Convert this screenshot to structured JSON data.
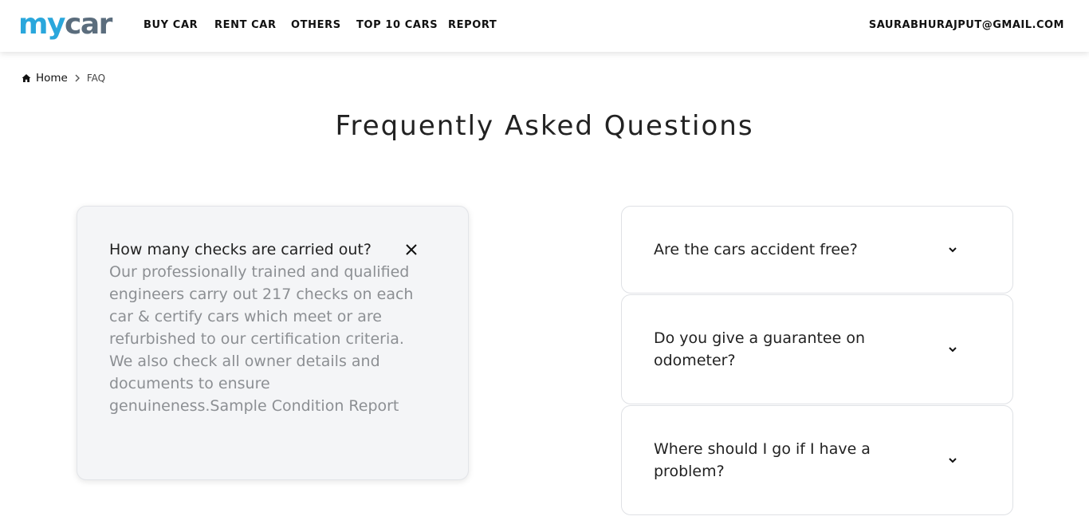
{
  "header": {
    "logo_part1": "my",
    "logo_part2": "car",
    "nav": [
      "BUY CAR",
      "RENT CAR",
      "OTHERS",
      "TOP 10 CARS",
      "REPORT"
    ],
    "user_email": "SAURABHURAJPUT@GMAIL.COM"
  },
  "breadcrumb": {
    "home": "Home",
    "current": "FAQ",
    "home_icon": "home-icon",
    "separator_icon": "chevron-right-icon"
  },
  "page_title": "Frequently Asked Questions",
  "faq": {
    "open": {
      "question": "How many checks are carried out?",
      "answer": "Our professionally trained and qualified engineers carry out 217 checks on each car & certify cars which meet or are refurbished to our certification criteria. We also check all owner details and documents to ensure genuineness.Sample Condition Report",
      "icon": "close-icon"
    },
    "items": [
      {
        "question": "Are the cars accident free?",
        "icon": "chevron-down-icon"
      },
      {
        "question": "Do you give a guarantee on odometer?",
        "icon": "chevron-down-icon"
      },
      {
        "question": "Where should I go if I have a problem?",
        "icon": "chevron-down-icon"
      }
    ]
  },
  "colors": {
    "logo_blue": "#2aa7dc",
    "logo_gray": "#5b6d7d",
    "answer_text": "#8c8f93",
    "open_card_bg": "#f4f5f7"
  }
}
